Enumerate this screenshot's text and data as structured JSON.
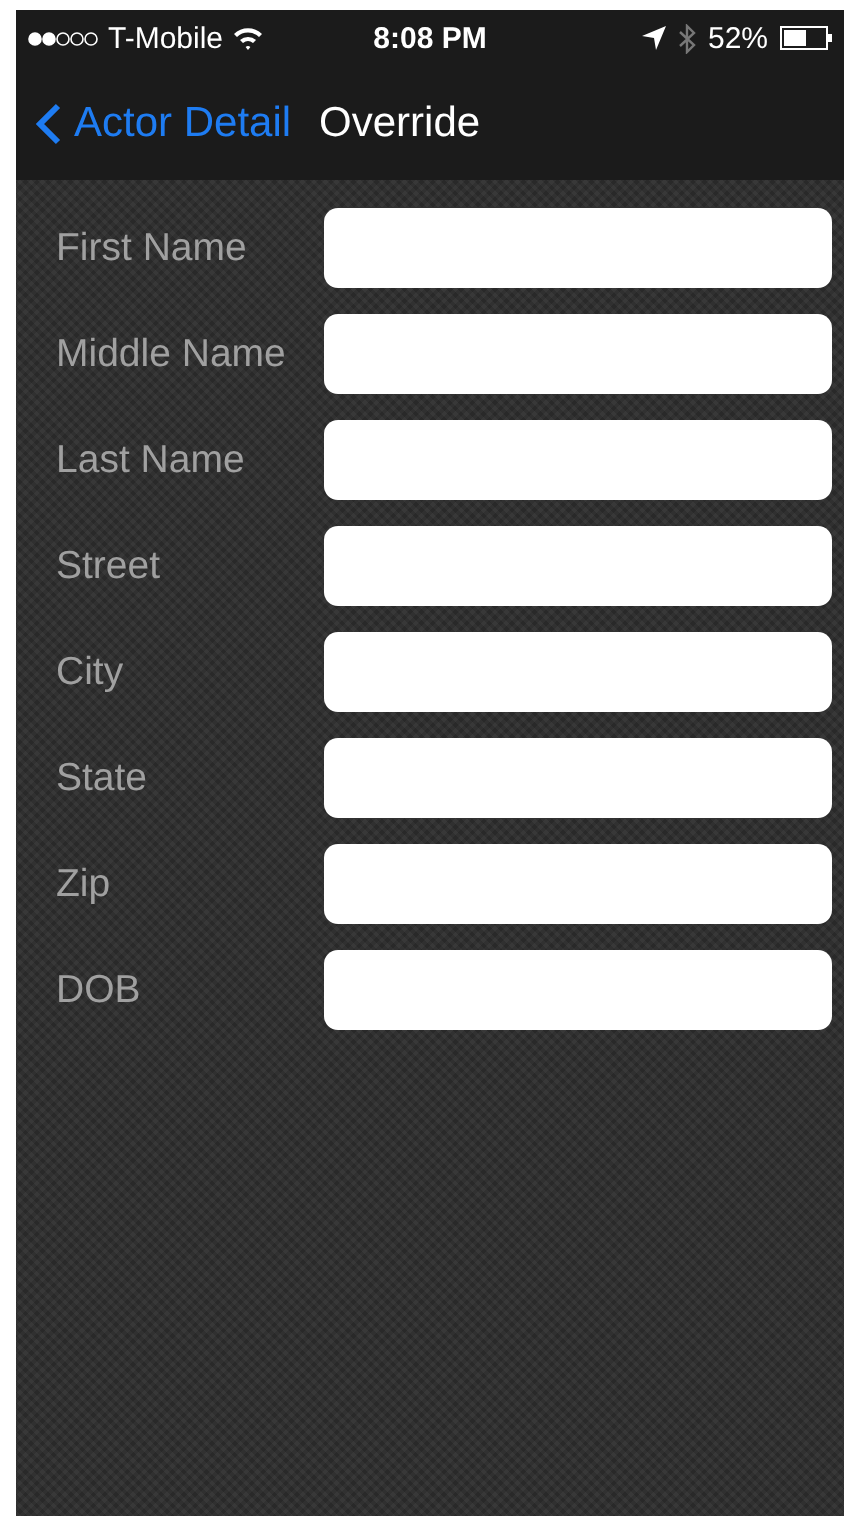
{
  "status_bar": {
    "carrier": "T-Mobile",
    "time": "8:08 PM",
    "battery": "52%"
  },
  "nav": {
    "back": "Actor Detail",
    "title": "Override"
  },
  "fields": [
    {
      "label": "First Name"
    },
    {
      "label": "Middle Name"
    },
    {
      "label": "Last Name"
    },
    {
      "label": "Street"
    },
    {
      "label": "City"
    },
    {
      "label": "State"
    },
    {
      "label": "Zip"
    },
    {
      "label": "DOB"
    }
  ]
}
